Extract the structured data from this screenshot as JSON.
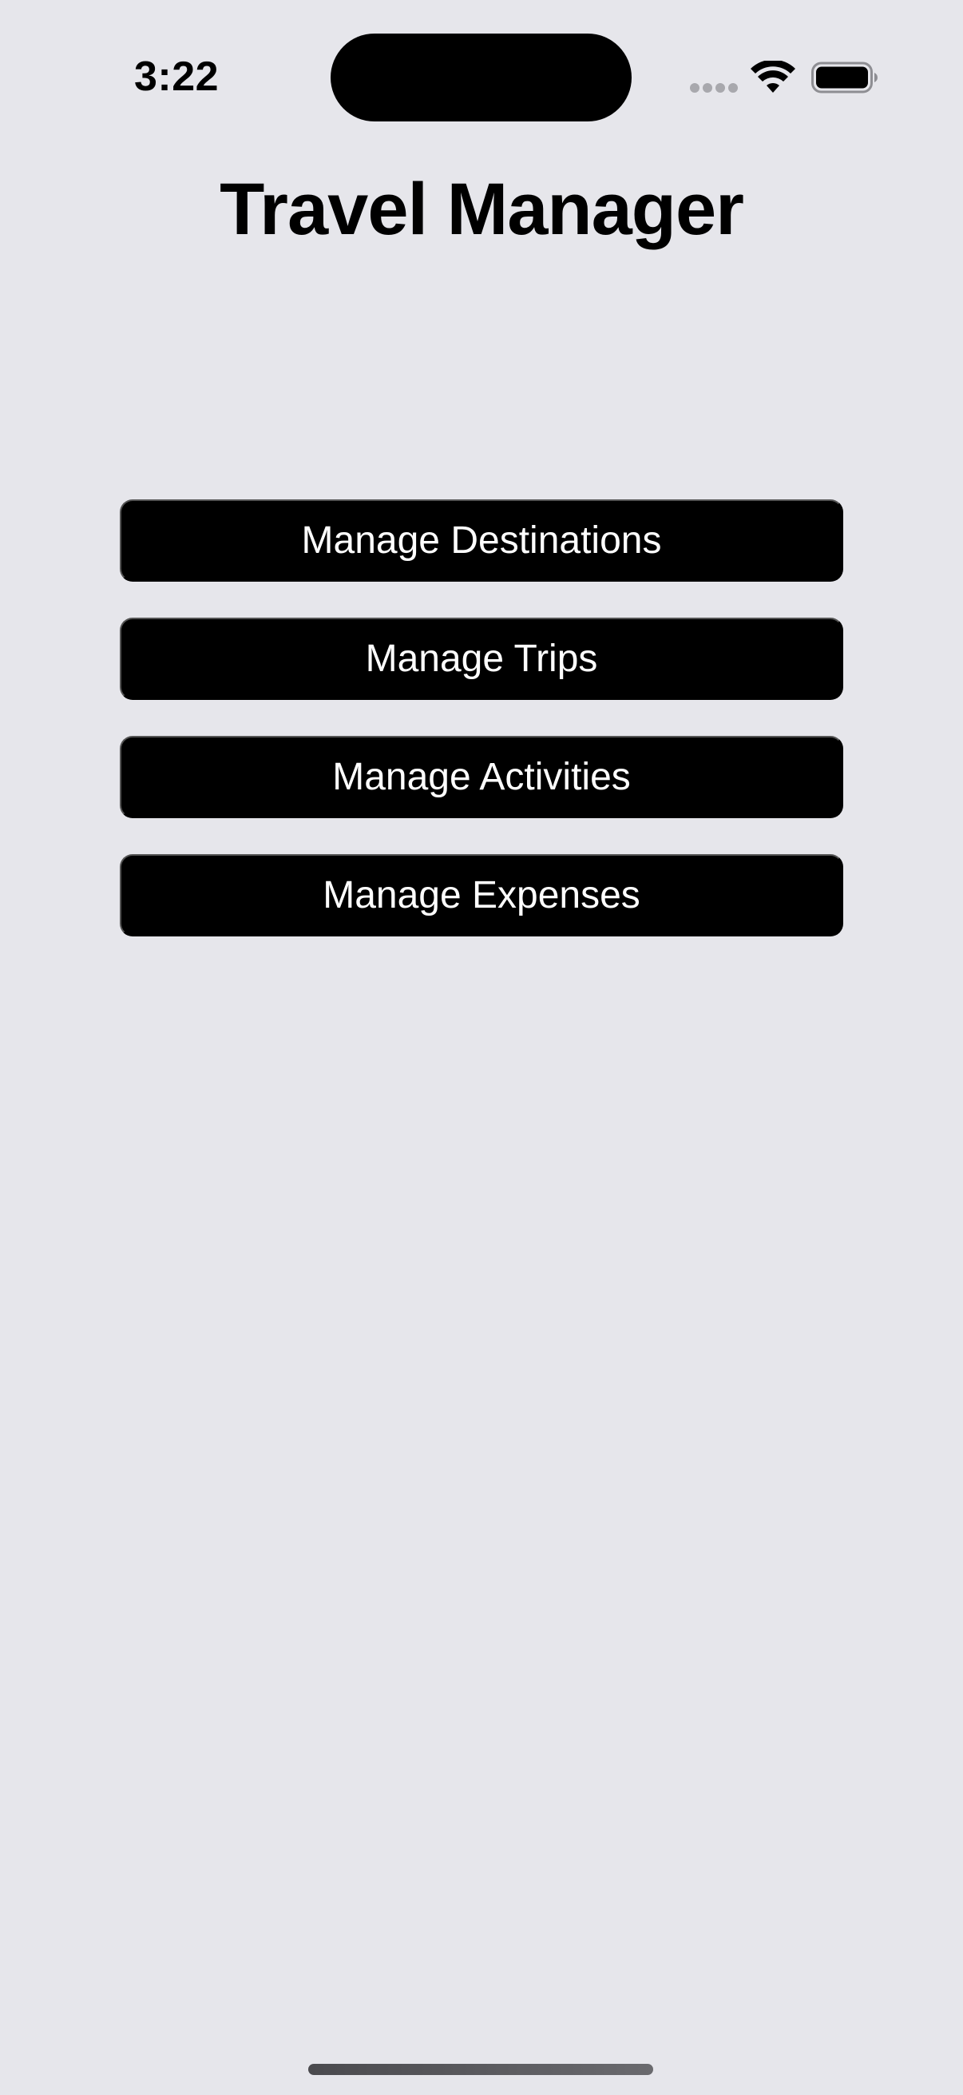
{
  "status_bar": {
    "time": "3:22"
  },
  "app": {
    "title": "Travel Manager"
  },
  "menu": {
    "buttons": [
      {
        "label": "Manage Destinations"
      },
      {
        "label": "Manage Trips"
      },
      {
        "label": "Manage Activities"
      },
      {
        "label": "Manage Expenses"
      }
    ]
  },
  "icons": {
    "signal": "cellular-signal-icon",
    "wifi": "wifi-icon",
    "battery": "battery-icon"
  },
  "colors": {
    "background": "#e6e6eb",
    "button_background": "#000000",
    "button_text": "#ffffff",
    "title_text": "#000000"
  }
}
